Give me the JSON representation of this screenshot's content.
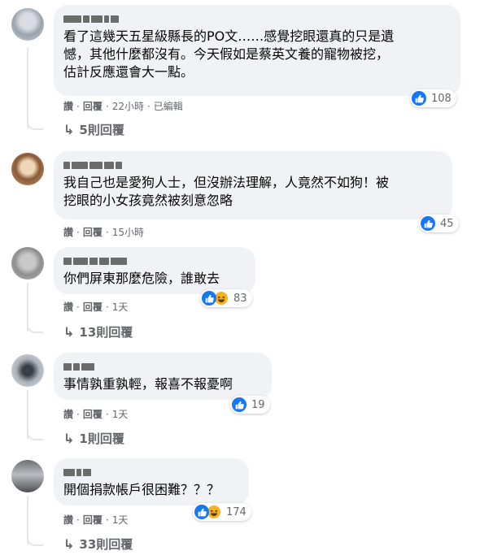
{
  "comments": [
    {
      "text": "看了這幾天五星級縣長的PO文……感覺挖眼還真的只是遺\n憾，其他什麼都沒有。今天假如是蔡英文養的寵物被挖，\n估計反應還會大一點。",
      "reaction_count": "108",
      "reactions": [
        "like-icon"
      ],
      "actions": {
        "like": "讚",
        "reply": "回覆",
        "time": "22小時",
        "edited": "已編輯"
      },
      "replies_label": "5則回覆"
    },
    {
      "text": "我自己也是愛狗人士，但沒辦法理解，人竟然不如狗！被\n挖眼的小女孩竟然被刻意忽略",
      "reaction_count": "45",
      "reactions": [
        "like-icon"
      ],
      "actions": {
        "like": "讚",
        "reply": "回覆",
        "time": "15小時"
      }
    },
    {
      "text": "你們屏東那麼危險，誰敢去",
      "reaction_count": "83",
      "reactions": [
        "like-icon",
        "haha-icon"
      ],
      "actions": {
        "like": "讚",
        "reply": "回覆",
        "time": "1天"
      },
      "replies_label": "13則回覆"
    },
    {
      "text": "事情孰重孰輕，報喜不報憂啊",
      "reaction_count": "19",
      "reactions": [
        "like-icon"
      ],
      "actions": {
        "like": "讚",
        "reply": "回覆",
        "time": "1天"
      },
      "replies_label": "1則回覆"
    },
    {
      "text": "開個捐款帳戶很困難？？？",
      "reaction_count": "174",
      "reactions": [
        "like-icon",
        "haha-icon"
      ],
      "actions": {
        "like": "讚",
        "reply": "回覆",
        "time": "1天"
      },
      "replies_label": "33則回覆"
    }
  ],
  "separator": "·",
  "reply_arrow_icon": "reply-arrow-icon",
  "colors": {
    "like": "#1877f2",
    "haha": "#f7b125",
    "bubble": "#f0f2f5",
    "meta": "#65676b"
  }
}
